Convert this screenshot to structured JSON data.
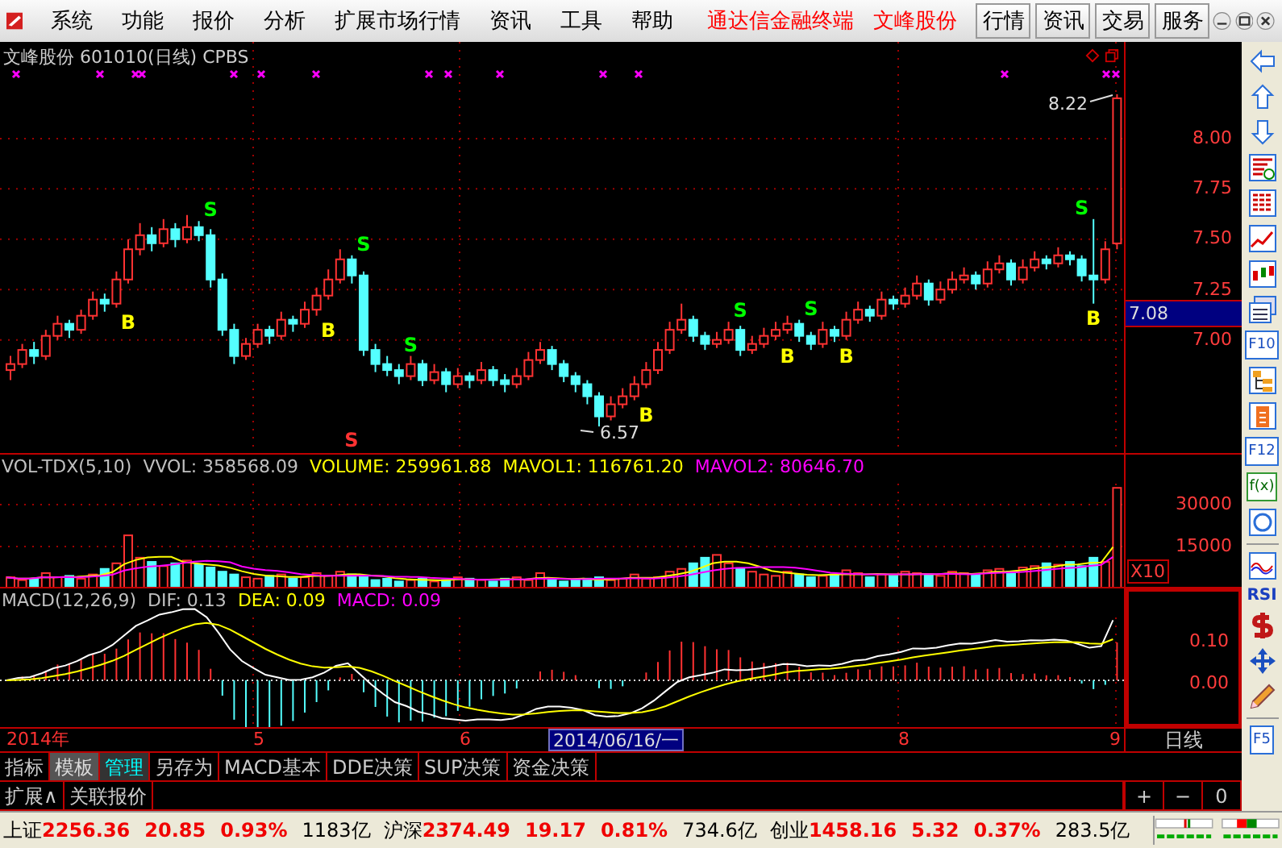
{
  "menu": {
    "items": [
      "系统",
      "功能",
      "报价",
      "分析",
      "扩展市场行情",
      "资讯",
      "工具",
      "帮助"
    ],
    "brand": "通达信金融终端",
    "stock": "文峰股份",
    "buttons": [
      "行情",
      "资讯",
      "交易",
      "服务"
    ]
  },
  "chart": {
    "title": "文峰股份 601010(日线) CPBS",
    "high_label": "8.22",
    "low_label": "6.57",
    "current_price": "7.08",
    "chart_data": {
      "type": "candlestick",
      "ylim": [
        6.43,
        8.48
      ],
      "grid": true,
      "yticks": [
        {
          "value": 8,
          "label": "8.00"
        },
        {
          "value": 7.75,
          "label": "7.75"
        },
        {
          "value": 7.5,
          "label": "7.50"
        },
        {
          "value": 7.25,
          "label": "7.25"
        },
        {
          "value": 7,
          "label": "7.00"
        }
      ],
      "ohlc": [
        [
          6.85,
          6.92,
          6.8,
          6.88
        ],
        [
          6.88,
          6.98,
          6.86,
          6.95
        ],
        [
          6.95,
          6.99,
          6.88,
          6.92
        ],
        [
          6.92,
          7.05,
          6.9,
          7.02
        ],
        [
          7.02,
          7.12,
          7.0,
          7.08
        ],
        [
          7.08,
          7.1,
          7.01,
          7.05
        ],
        [
          7.05,
          7.15,
          7.03,
          7.12
        ],
        [
          7.12,
          7.24,
          7.1,
          7.2
        ],
        [
          7.2,
          7.23,
          7.14,
          7.18
        ],
        [
          7.18,
          7.34,
          7.16,
          7.3
        ],
        [
          7.3,
          7.5,
          7.28,
          7.45
        ],
        [
          7.45,
          7.58,
          7.42,
          7.52
        ],
        [
          7.52,
          7.56,
          7.44,
          7.48
        ],
        [
          7.48,
          7.6,
          7.46,
          7.55
        ],
        [
          7.55,
          7.58,
          7.46,
          7.5
        ],
        [
          7.5,
          7.62,
          7.48,
          7.56
        ],
        [
          7.56,
          7.59,
          7.49,
          7.52
        ],
        [
          7.52,
          7.55,
          7.26,
          7.3
        ],
        [
          7.3,
          7.33,
          7.02,
          7.05
        ],
        [
          7.05,
          7.08,
          6.88,
          6.92
        ],
        [
          6.92,
          7.01,
          6.9,
          6.98
        ],
        [
          6.98,
          7.08,
          6.96,
          7.05
        ],
        [
          7.05,
          7.07,
          6.98,
          7.02
        ],
        [
          7.02,
          7.14,
          7.0,
          7.1
        ],
        [
          7.1,
          7.12,
          7.04,
          7.08
        ],
        [
          7.08,
          7.19,
          7.06,
          7.15
        ],
        [
          7.15,
          7.26,
          7.12,
          7.22
        ],
        [
          7.22,
          7.35,
          7.2,
          7.3
        ],
        [
          7.3,
          7.45,
          7.28,
          7.4
        ],
        [
          7.4,
          7.42,
          7.28,
          7.32
        ],
        [
          7.32,
          7.34,
          6.92,
          6.95
        ],
        [
          6.95,
          6.98,
          6.84,
          6.88
        ],
        [
          6.88,
          6.92,
          6.82,
          6.85
        ],
        [
          6.85,
          6.88,
          6.78,
          6.82
        ],
        [
          6.82,
          6.92,
          6.8,
          6.88
        ],
        [
          6.88,
          6.9,
          6.77,
          6.8
        ],
        [
          6.8,
          6.88,
          6.78,
          6.84
        ],
        [
          6.84,
          6.86,
          6.74,
          6.78
        ],
        [
          6.78,
          6.86,
          6.76,
          6.82
        ],
        [
          6.82,
          6.84,
          6.76,
          6.8
        ],
        [
          6.8,
          6.89,
          6.78,
          6.85
        ],
        [
          6.85,
          6.87,
          6.77,
          6.8
        ],
        [
          6.8,
          6.83,
          6.74,
          6.78
        ],
        [
          6.78,
          6.86,
          6.76,
          6.82
        ],
        [
          6.82,
          6.94,
          6.8,
          6.9
        ],
        [
          6.9,
          6.99,
          6.88,
          6.95
        ],
        [
          6.95,
          6.97,
          6.85,
          6.88
        ],
        [
          6.88,
          6.9,
          6.79,
          6.82
        ],
        [
          6.82,
          6.84,
          6.74,
          6.78
        ],
        [
          6.78,
          6.8,
          6.68,
          6.72
        ],
        [
          6.72,
          6.74,
          6.57,
          6.62
        ],
        [
          6.62,
          6.72,
          6.6,
          6.68
        ],
        [
          6.68,
          6.76,
          6.66,
          6.72
        ],
        [
          6.72,
          6.82,
          6.7,
          6.78
        ],
        [
          6.78,
          6.89,
          6.76,
          6.85
        ],
        [
          6.85,
          6.99,
          6.83,
          6.95
        ],
        [
          6.95,
          7.09,
          6.93,
          7.05
        ],
        [
          7.05,
          7.18,
          7.03,
          7.1
        ],
        [
          7.1,
          7.12,
          6.99,
          7.02
        ],
        [
          7.02,
          7.04,
          6.95,
          6.98
        ],
        [
          6.98,
          7.04,
          6.96,
          7.0
        ],
        [
          7.0,
          7.09,
          6.98,
          7.05
        ],
        [
          7.05,
          7.07,
          6.92,
          6.95
        ],
        [
          6.95,
          7.02,
          6.93,
          6.98
        ],
        [
          6.98,
          7.06,
          6.96,
          7.02
        ],
        [
          7.02,
          7.09,
          7.0,
          7.05
        ],
        [
          7.05,
          7.12,
          7.03,
          7.08
        ],
        [
          7.08,
          7.1,
          6.99,
          7.02
        ],
        [
          7.02,
          7.04,
          6.95,
          6.98
        ],
        [
          6.98,
          7.09,
          6.96,
          7.05
        ],
        [
          7.05,
          7.07,
          6.99,
          7.02
        ],
        [
          7.02,
          7.14,
          7.0,
          7.1
        ],
        [
          7.1,
          7.19,
          7.08,
          7.15
        ],
        [
          7.15,
          7.17,
          7.09,
          7.12
        ],
        [
          7.12,
          7.24,
          7.1,
          7.2
        ],
        [
          7.2,
          7.22,
          7.15,
          7.18
        ],
        [
          7.18,
          7.26,
          7.16,
          7.22
        ],
        [
          7.22,
          7.32,
          7.2,
          7.28
        ],
        [
          7.28,
          7.3,
          7.17,
          7.2
        ],
        [
          7.2,
          7.29,
          7.18,
          7.25
        ],
        [
          7.25,
          7.34,
          7.23,
          7.3
        ],
        [
          7.3,
          7.36,
          7.28,
          7.32
        ],
        [
          7.32,
          7.34,
          7.25,
          7.28
        ],
        [
          7.28,
          7.39,
          7.26,
          7.35
        ],
        [
          7.35,
          7.42,
          7.33,
          7.38
        ],
        [
          7.38,
          7.4,
          7.27,
          7.3
        ],
        [
          7.3,
          7.4,
          7.28,
          7.36
        ],
        [
          7.36,
          7.44,
          7.34,
          7.4
        ],
        [
          7.4,
          7.42,
          7.35,
          7.38
        ],
        [
          7.38,
          7.46,
          7.36,
          7.42
        ],
        [
          7.42,
          7.44,
          7.37,
          7.4
        ],
        [
          7.4,
          7.42,
          7.29,
          7.32
        ],
        [
          7.32,
          7.6,
          7.18,
          7.3
        ],
        [
          7.3,
          7.49,
          7.28,
          7.45
        ],
        [
          7.48,
          8.22,
          7.45,
          8.2
        ]
      ]
    },
    "signals": [
      {
        "label": "S",
        "color": "#00ff00"
      },
      {
        "label": "B",
        "color": "#ffff00"
      },
      {
        "label": "B",
        "color": "#ffff00"
      },
      {
        "label": "S",
        "color": "#00ff00"
      },
      {
        "label": "S",
        "color": "#ff3232"
      },
      {
        "label": "S",
        "color": "#00ff00"
      },
      {
        "label": "B",
        "color": "#ffff00"
      },
      {
        "label": "S",
        "color": "#00ff00"
      },
      {
        "label": "B",
        "color": "#ffff00"
      },
      {
        "label": "S",
        "color": "#00ff00"
      },
      {
        "label": "B",
        "color": "#ffff00"
      },
      {
        "label": "S",
        "color": "#00ff00"
      },
      {
        "label": "B",
        "color": "#ffff00"
      }
    ]
  },
  "volume": {
    "legend": [
      {
        "text": "VOL-TDX(5,10)",
        "color": "#c0c0c0"
      },
      {
        "text": "VVOL: 358568.09",
        "color": "#c0c0c0"
      },
      {
        "text": "VOLUME: 259961.88",
        "color": "#ffff00"
      },
      {
        "text": "MAVOL1: 116761.20",
        "color": "#ffff00"
      },
      {
        "text": "MAVOL2: 80646.70",
        "color": "#ff00ff"
      }
    ],
    "ticks": [
      "30000",
      "15000"
    ],
    "scale": "X10"
  },
  "macd": {
    "legend": [
      {
        "text": "MACD(12,26,9)",
        "color": "#c0c0c0"
      },
      {
        "text": "DIF: 0.13",
        "color": "#c0c0c0"
      },
      {
        "text": "DEA: 0.09",
        "color": "#ffff00"
      },
      {
        "text": "MACD: 0.09",
        "color": "#ff00ff"
      }
    ],
    "ticks": [
      "0.10",
      "0.00"
    ]
  },
  "date_axis": {
    "labels": [
      "2014年",
      "5",
      "6",
      "8",
      "9"
    ],
    "cursor_date": "2014/06/16/一",
    "period": "日线"
  },
  "tabs": [
    {
      "label": "指标",
      "selected": false,
      "pressed": false
    },
    {
      "label": "模板",
      "selected": false,
      "pressed": true
    },
    {
      "label": "管理",
      "selected": true,
      "pressed": false
    },
    {
      "label": "另存为",
      "selected": false,
      "pressed": false
    },
    {
      "label": "MACD基本",
      "selected": false,
      "pressed": false
    },
    {
      "label": "DDE决策",
      "selected": false,
      "pressed": false
    },
    {
      "label": "SUP决策",
      "selected": false,
      "pressed": false
    },
    {
      "label": "资金决策",
      "selected": false,
      "pressed": false
    }
  ],
  "tabs_row2": [
    "扩展∧",
    "关联报价"
  ],
  "zoom_buttons": [
    "+",
    "−",
    "0"
  ],
  "toolbar": [
    {
      "kind": "arrow-left"
    },
    {
      "kind": "arrow-up"
    },
    {
      "kind": "arrow-down"
    },
    {
      "kind": "report"
    },
    {
      "kind": "table"
    },
    {
      "kind": "line-chart"
    },
    {
      "kind": "candles"
    },
    {
      "kind": "windows"
    },
    {
      "kind": "text",
      "label": "F10"
    },
    {
      "kind": "tree"
    },
    {
      "kind": "clipboard"
    },
    {
      "kind": "text",
      "label": "F12"
    },
    {
      "kind": "text-green",
      "label": "f(x)"
    },
    {
      "kind": "circle"
    },
    {
      "kind": "separator"
    },
    {
      "kind": "wave"
    },
    {
      "kind": "bold",
      "label": "RSI"
    },
    {
      "kind": "dollar"
    },
    {
      "kind": "move"
    },
    {
      "kind": "pencil"
    },
    {
      "kind": "separator"
    },
    {
      "kind": "text",
      "label": "F5"
    }
  ],
  "status": {
    "indices": [
      {
        "name": "上证",
        "value": "2256.36",
        "change": "20.85",
        "percent": "0.93%",
        "amount": "1183亿"
      },
      {
        "name": "沪深",
        "value": "2374.49",
        "change": "19.17",
        "percent": "0.81%",
        "amount": "734.6亿"
      },
      {
        "name": "创业",
        "value": "1458.16",
        "change": "5.32",
        "percent": "0.37%",
        "amount": "283.5亿"
      }
    ]
  }
}
